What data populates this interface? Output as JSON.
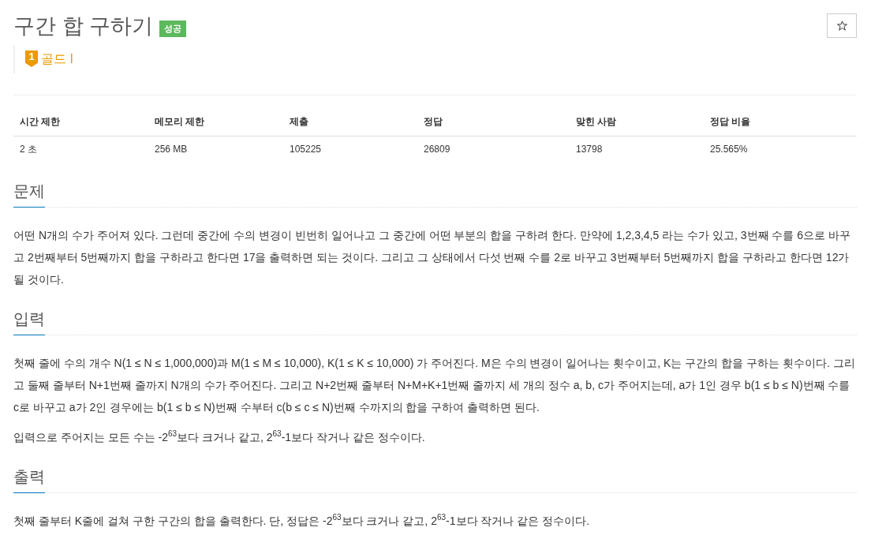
{
  "header": {
    "title": "구간 합 구하기",
    "status_badge": "성공",
    "star_button": {
      "starred": false
    }
  },
  "tier": {
    "number": "1",
    "label": "골드 I"
  },
  "stats_table": {
    "columns": [
      "시간 제한",
      "메모리 제한",
      "제출",
      "정답",
      "맞힌 사람",
      "정답 비율"
    ],
    "rows": [
      [
        "2 초",
        "256 MB",
        "105225",
        "26809",
        "13798",
        "25.565%"
      ]
    ]
  },
  "sections": [
    {
      "heading": "문제",
      "paragraphs": [
        "어떤 N개의 수가 주어져 있다. 그런데 중간에 수의 변경이 빈번히 일어나고 그 중간에 어떤 부분의 합을 구하려 한다. 만약에 1,2,3,4,5 라는 수가 있고, 3번째 수를 6으로 바꾸고 2번째부터 5번째까지 합을 구하라고 한다면 17을 출력하면 되는 것이다. 그리고 그 상태에서 다섯 번째 수를 2로 바꾸고 3번째부터 5번째까지 합을 구하라고 한다면 12가 될 것이다."
      ]
    },
    {
      "heading": "입력",
      "paragraphs": [
        "첫째 줄에 수의 개수 N(1 ≤ N ≤ 1,000,000)과 M(1 ≤ M ≤ 10,000), K(1 ≤ K ≤ 10,000) 가 주어진다. M은 수의 변경이 일어나는 횟수이고, K는 구간의 합을 구하는 횟수이다. 그리고 둘째 줄부터 N+1번째 줄까지 N개의 수가 주어진다. 그리고 N+2번째 줄부터 N+M+K+1번째 줄까지 세 개의 정수 a, b, c가 주어지는데, a가 1인 경우 b(1 ≤ b ≤ N)번째 수를 c로 바꾸고 a가 2인 경우에는 b(1 ≤ b ≤ N)번째 수부터 c(b ≤ c ≤ N)번째 수까지의 합을 구하여 출력하면 된다.",
        "입력으로 주어지는 모든 수는 -2$^{63}$보다 크거나 같고, 2$^{63}$-1보다 작거나 같은 정수이다."
      ]
    },
    {
      "heading": "출력",
      "paragraphs": [
        "첫째 줄부터 K줄에 걸쳐 구한 구간의 합을 출력한다. 단, 정답은 -2$^{63}$보다 크거나 같고, 2$^{63}$-1보다 작거나 같은 정수이다."
      ]
    }
  ]
}
